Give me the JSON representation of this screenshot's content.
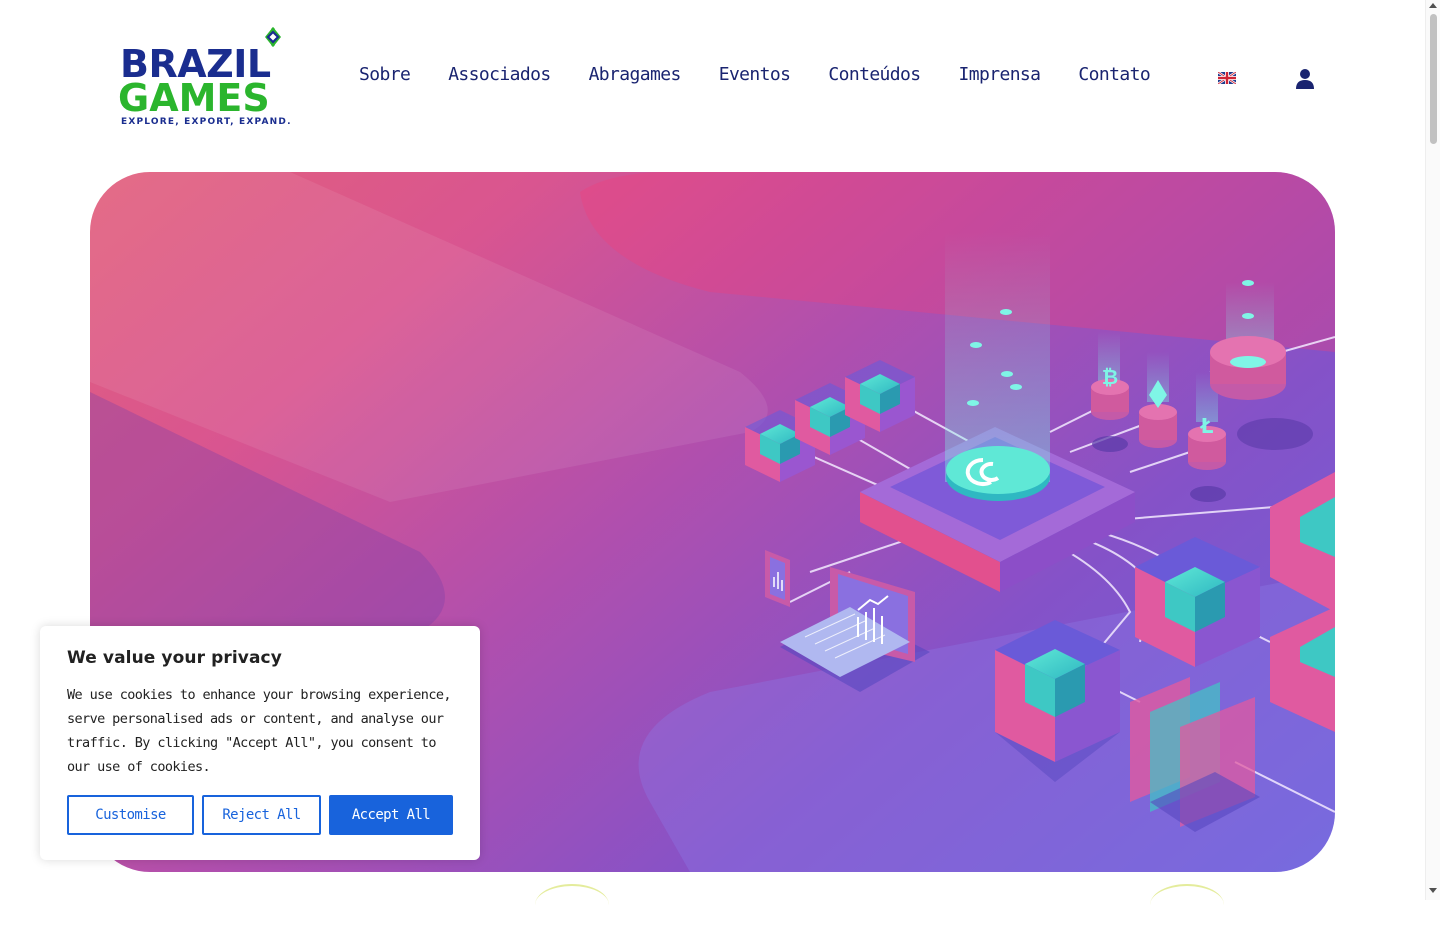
{
  "logo": {
    "line1": "BRAZIL",
    "line2": "GAMES",
    "tagline": "EXPLORE, EXPORT, EXPAND."
  },
  "nav": {
    "items": [
      "Sobre",
      "Associados",
      "Abragames",
      "Eventos",
      "Conteúdos",
      "Imprensa",
      "Contato"
    ],
    "language_icon": "uk-flag-icon",
    "account_icon": "user-icon"
  },
  "hero": {
    "illustration": "isometric-crypto-blockchain-illustration"
  },
  "cookie_banner": {
    "title": "We value your privacy",
    "description": "We use cookies to enhance your browsing experience, serve personalised ads or content, and analyse our traffic. By clicking \"Accept All\", you consent to our use of cookies.",
    "customise_label": "Customise",
    "reject_label": "Reject All",
    "accept_label": "Accept All"
  },
  "colors": {
    "brand_blue": "#1a2d8f",
    "brand_green": "#2bb52d",
    "nav_text": "#1a2470",
    "cookie_accent": "#1863dc"
  }
}
